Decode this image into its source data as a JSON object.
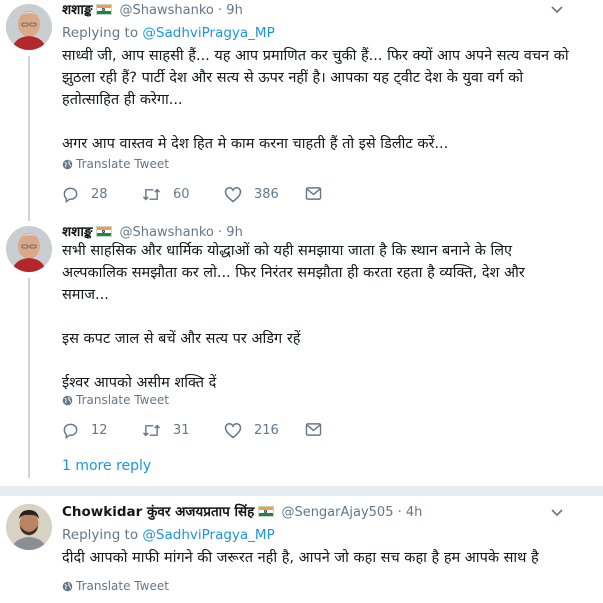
{
  "tweets": [
    {
      "display_name": "शशाङ्क",
      "handle": "@Shawshanko",
      "dot": "·",
      "time": "9h",
      "replying_prefix": "Replying to",
      "replying_to": "@SadhviPragya_MP",
      "text": "साध्वी जी, आप साहसी हैं... यह आप प्रमाणित कर चुकी हैं... फिर क्यों आप अपने सत्य वचन को झुठला रही हैं? पार्टी देश और सत्य से ऊपर नहीं है। आपका यह ट्वीट देश के युवा वर्ग को हतोत्साहित ही करेगा...\n\nअगर आप वास्तव मे देश हित मे काम करना चाहती हैं तो इसे डिलीट करें...",
      "translate": "Translate Tweet",
      "replies": "28",
      "retweets": "60",
      "likes": "386"
    },
    {
      "display_name": "शशाङ्क",
      "handle": "@Shawshanko",
      "dot": "·",
      "time": "9h",
      "text": "सभी साहसिक और धार्मिक योद्धाओं को यही समझाया जाता है कि स्थान बनाने के लिए अल्पकालिक समझौता कर लो... फिर निरंतर समझौता ही करता रहता है व्यक्ति, देश और समाज...\n\nइस कपट जाल से बचें और सत्य पर अडिग रहें\n\nईश्वर आपको असीम शक्ति दें",
      "translate": "Translate Tweet",
      "replies": "12",
      "retweets": "31",
      "likes": "216"
    },
    {
      "display_name": "Chowkidar कुंवर अजयप्रताप सिंह",
      "handle": "@SengarAjay505",
      "dot": "·",
      "time": "4h",
      "replying_prefix": "Replying to",
      "replying_to": "@SadhviPragya_MP",
      "text": "दीदी आपको माफी मांगने की जरूरत नही है, आपने जो कहा सच कहा है हम आपके साथ है",
      "translate": "Translate Tweet"
    }
  ],
  "more_reply": "1 more reply",
  "colors": {
    "accent": "#1b95e0",
    "muted": "#657786",
    "divider": "#e6ecf0"
  },
  "icons": [
    "reply-icon",
    "retweet-icon",
    "like-icon",
    "direct-message-icon",
    "globe-icon",
    "chevron-down-icon"
  ]
}
